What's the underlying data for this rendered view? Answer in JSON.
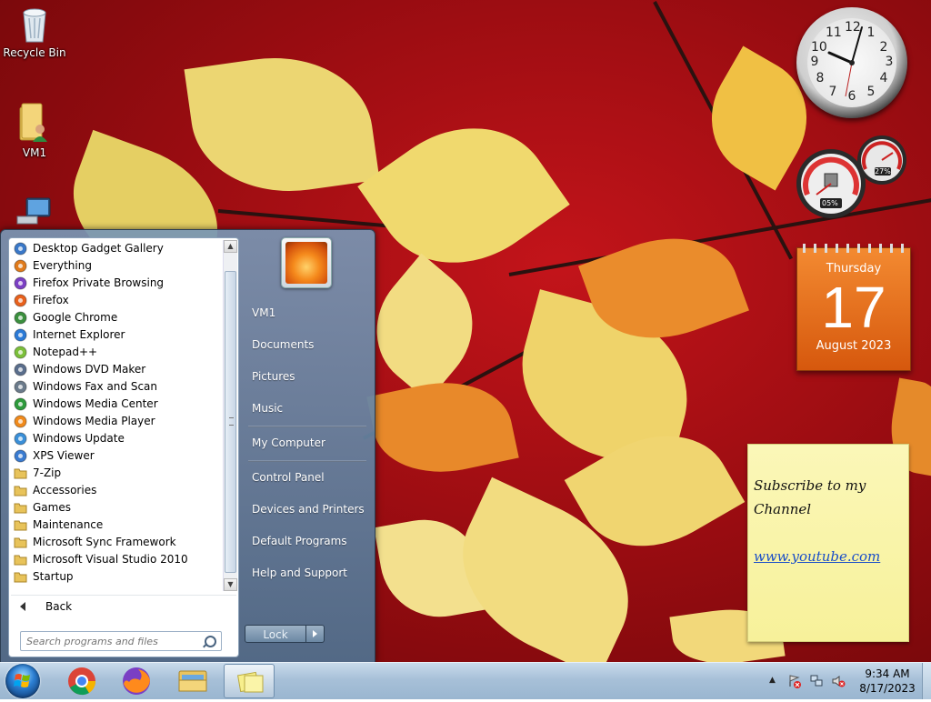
{
  "desktop": {
    "icons": [
      {
        "label": "Recycle Bin"
      },
      {
        "label": "VM1"
      }
    ]
  },
  "gadgets": {
    "clock": {
      "numbers": [
        "12",
        "1",
        "2",
        "3",
        "4",
        "5",
        "6",
        "7",
        "8",
        "9",
        "10",
        "11"
      ]
    },
    "cpu_meter": {
      "cpu": "05%",
      "memory": "27%"
    },
    "calendar": {
      "weekday": "Thursday",
      "day": "17",
      "month_year": "August 2023"
    },
    "sticky_note": {
      "line1": "Subscribe to my",
      "line2": "Channel",
      "link": "www.youtube.com"
    }
  },
  "start_menu": {
    "programs": [
      {
        "label": "Desktop Gadget Gallery",
        "icon": "gadget-gallery-icon",
        "color": "#3a78c8"
      },
      {
        "label": "Everything",
        "icon": "everything-search-icon",
        "color": "#e07b1c"
      },
      {
        "label": "Firefox Private Browsing",
        "icon": "firefox-private-icon",
        "color": "#7b3fc4"
      },
      {
        "label": "Firefox",
        "icon": "firefox-icon",
        "color": "#e8611c"
      },
      {
        "label": "Google Chrome",
        "icon": "chrome-icon",
        "color": "#3b8f3e"
      },
      {
        "label": "Internet Explorer",
        "icon": "internet-explorer-icon",
        "color": "#2b7ad6"
      },
      {
        "label": "Notepad++",
        "icon": "notepad-plus-plus-icon",
        "color": "#7bbf3a"
      },
      {
        "label": "Windows DVD Maker",
        "icon": "dvd-maker-icon",
        "color": "#5a6e8c"
      },
      {
        "label": "Windows Fax and Scan",
        "icon": "fax-scan-icon",
        "color": "#6b7b8b"
      },
      {
        "label": "Windows Media Center",
        "icon": "media-center-icon",
        "color": "#2d9a3c"
      },
      {
        "label": "Windows Media Player",
        "icon": "media-player-icon",
        "color": "#f08a1c"
      },
      {
        "label": "Windows Update",
        "icon": "windows-update-icon",
        "color": "#3a8fd8"
      },
      {
        "label": "XPS Viewer",
        "icon": "xps-viewer-icon",
        "color": "#3a7bd0"
      },
      {
        "label": "7-Zip",
        "icon": "folder-icon",
        "color": "#e8c35a"
      },
      {
        "label": "Accessories",
        "icon": "folder-icon",
        "color": "#e8c35a"
      },
      {
        "label": "Games",
        "icon": "folder-icon",
        "color": "#e8c35a"
      },
      {
        "label": "Maintenance",
        "icon": "folder-icon",
        "color": "#e8c35a"
      },
      {
        "label": "Microsoft Sync Framework",
        "icon": "folder-icon",
        "color": "#e8c35a"
      },
      {
        "label": "Microsoft Visual Studio 2010",
        "icon": "folder-icon",
        "color": "#e8c35a"
      },
      {
        "label": "Startup",
        "icon": "folder-icon",
        "color": "#e8c35a"
      }
    ],
    "back_label": "Back",
    "search_placeholder": "Search programs and files",
    "right_items": [
      "VM1",
      "Documents",
      "Pictures",
      "Music",
      "My Computer",
      "Control Panel",
      "Devices and Printers",
      "Default Programs",
      "Help and Support"
    ],
    "lock_label": "Lock"
  },
  "taskbar": {
    "pinned": [
      {
        "name": "chrome",
        "icon": "chrome-icon"
      },
      {
        "name": "firefox",
        "icon": "firefox-icon"
      },
      {
        "name": "file-explorer",
        "icon": "folder-icon"
      },
      {
        "name": "sticky-notes",
        "icon": "sticky-notes-icon"
      }
    ],
    "time": "9:34 AM",
    "date": "8/17/2023"
  }
}
